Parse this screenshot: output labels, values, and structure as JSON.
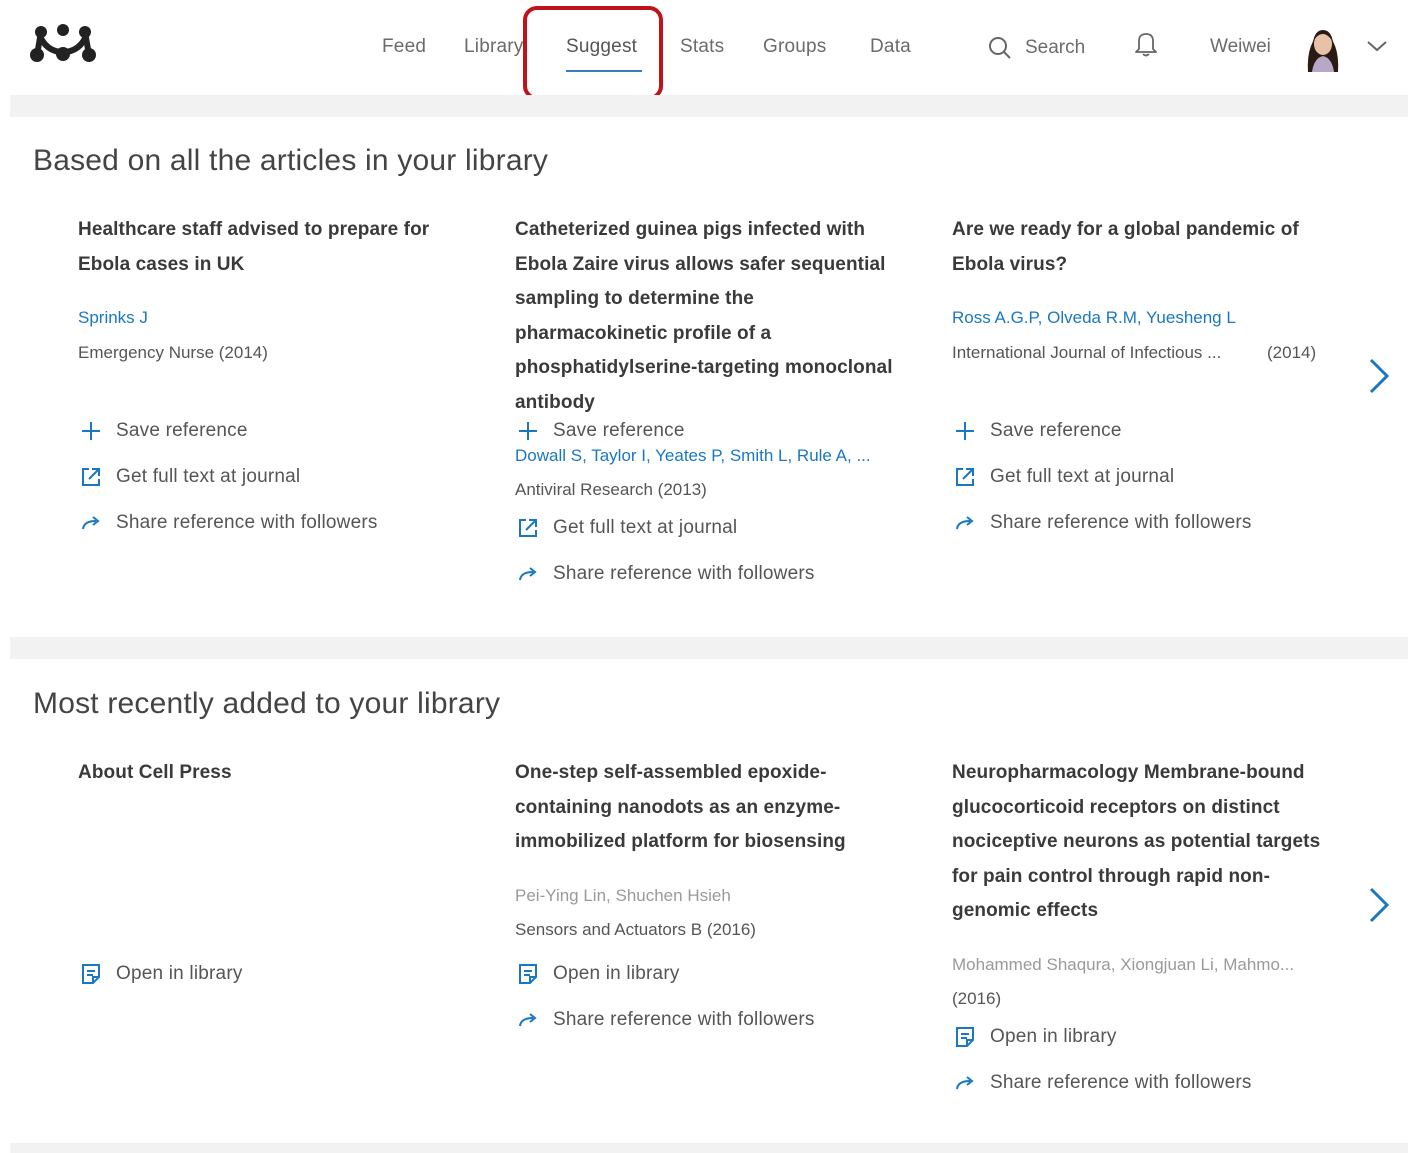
{
  "nav": {
    "items": [
      {
        "label": "Feed"
      },
      {
        "label": "Library"
      },
      {
        "label": "Suggest"
      },
      {
        "label": "Stats"
      },
      {
        "label": "Groups"
      },
      {
        "label": "Data"
      }
    ],
    "search_label": "Search",
    "username": "Weiwei"
  },
  "colors": {
    "accent": "#1a78c2",
    "highlight_box": "#c0121b",
    "band": "#f2f2f2"
  },
  "sections": [
    {
      "title": "Based on all the articles in your library",
      "cards": [
        {
          "title": "Healthcare staff advised to prepare for Ebola cases in UK",
          "authors": "Sprinks J",
          "journal": "Emergency Nurse (2014)",
          "actions": [
            "Save reference",
            "Get full text at journal",
            "Share reference with followers"
          ]
        },
        {
          "title": "Catheterized guinea pigs infected with Ebola Zaire virus allows safer sequential sampling to determine the pharmacokinetic profile of a phosphatidylserine-targeting monoclonal antibody",
          "authors": "Dowall S, Taylor I, Yeates P, Smith L, Rule A, ...",
          "journal": "Antiviral Research (2013)",
          "actions": [
            "Save reference",
            "Get full text at journal",
            "Share reference with followers"
          ]
        },
        {
          "title": "Are we ready for a global pandemic of Ebola virus?",
          "authors": "Ross A.G.P, Olveda R.M, Yuesheng L",
          "journal": "International Journal of Infectious ...",
          "year": "(2014)",
          "actions": [
            "Save reference",
            "Get full text at journal",
            "Share reference with followers"
          ]
        }
      ]
    },
    {
      "title": "Most recently added to your library",
      "cards": [
        {
          "title": "About Cell Press",
          "actions": [
            "Open in library"
          ]
        },
        {
          "title": "One-step self-assembled epoxide-containing nanodots as an enzyme-immobilized platform for biosensing",
          "authors": "Pei-Ying Lin, Shuchen Hsieh",
          "journal": "Sensors and Actuators B (2016)",
          "actions": [
            "Open in library",
            "Share reference with followers"
          ]
        },
        {
          "title": "Neuropharmacology Membrane-bound glucocorticoid receptors on distinct nociceptive neurons as potential targets for pain control through rapid non-genomic effects",
          "authors": "Mohammed Shaqura, Xiongjuan Li, Mahmo...",
          "journal": "(2016)",
          "actions": [
            "Open in library",
            "Share reference with followers"
          ]
        }
      ]
    }
  ],
  "icons": {
    "logo": "mendeley-logo",
    "search": "search-icon",
    "bell": "bell-icon",
    "save": "plus-icon",
    "fulltext": "external-link-icon",
    "share": "share-arrow-icon",
    "open": "document-icon",
    "next": "chevron-right-icon"
  }
}
